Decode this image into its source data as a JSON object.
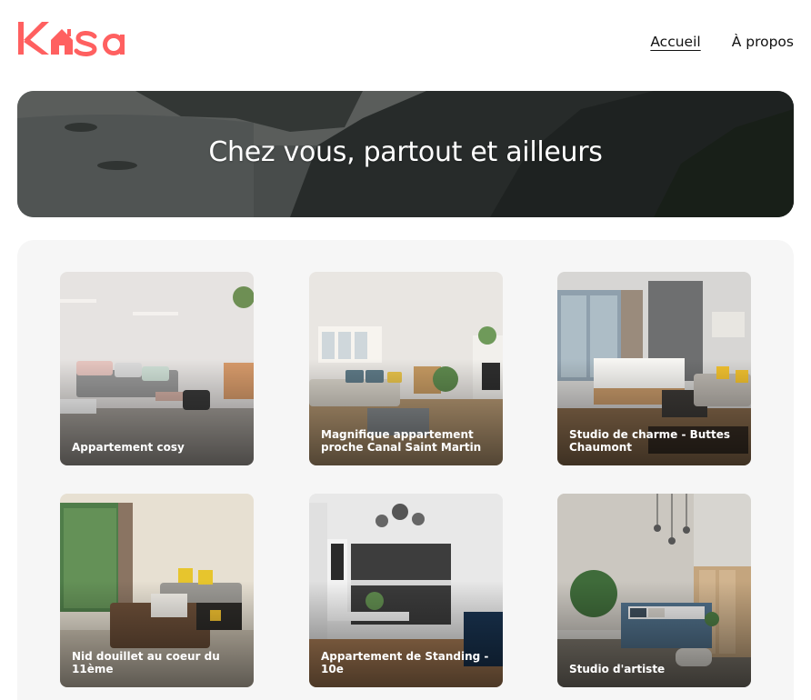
{
  "header": {
    "logo_text": "Kasa",
    "brand_color": "#ff6060",
    "nav": [
      {
        "label": "Accueil",
        "active": true
      },
      {
        "label": "À propos",
        "active": false
      }
    ]
  },
  "banner": {
    "title": "Chez vous, partout et ailleurs"
  },
  "listings": [
    {
      "title": "Appartement cosy"
    },
    {
      "title": "Magnifique appartement proche Canal Saint Martin"
    },
    {
      "title": "Studio de charme - Buttes Chaumont"
    },
    {
      "title": "Nid douillet au coeur du 11ème"
    },
    {
      "title": "Appartement de Standing - 10e"
    },
    {
      "title": "Studio d'artiste"
    }
  ]
}
